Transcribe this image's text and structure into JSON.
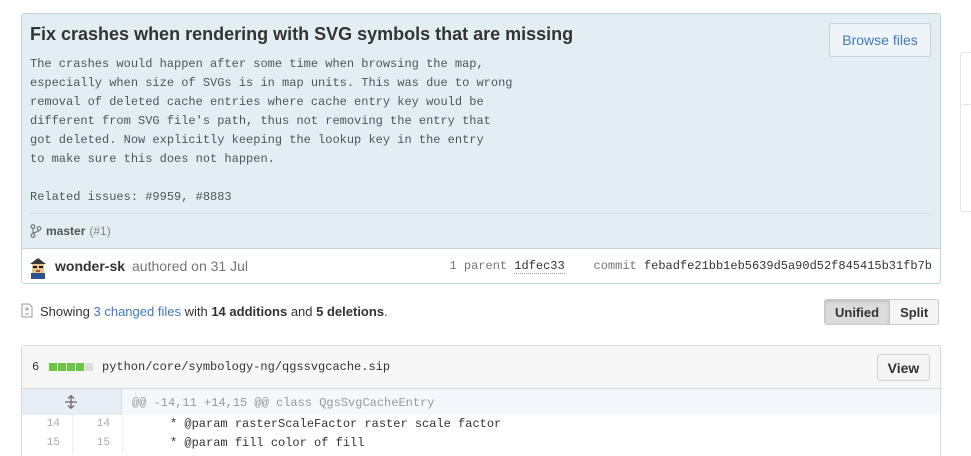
{
  "commit": {
    "title": "Fix crashes when rendering with SVG symbols that are missing",
    "description": "The crashes would happen after some time when browsing the map,\nespecially when size of SVGs is in map units. This was due to wrong\nremoval of deleted cache entries where cache entry key would be\ndifferent from SVG file's path, thus not removing the entry that\ngot deleted. Now explicitly keeping the lookup key in the entry\nto make sure this does not happen.\n\nRelated issues: #9959, #8883",
    "browse_label": "Browse files",
    "branch": "master",
    "pr": "(#1)",
    "author": "wonder-sk",
    "authored_text": "authored on 31 Jul",
    "parent_label": "1 parent",
    "parent_sha": "1dfec33",
    "commit_label": "commit",
    "commit_sha": "febadfe21bb1eb5639d5a90d52f845415b31fb7b"
  },
  "toc": {
    "showing": "Showing",
    "changed_files": "3 changed files",
    "with": "with",
    "additions": "14 additions",
    "and": "and",
    "deletions": "5 deletions",
    "period": ".",
    "unified": "Unified",
    "split": "Split"
  },
  "file": {
    "count": "6",
    "path": "python/core/symbology-ng/qgssvgcache.sip",
    "view_label": "View",
    "hunk": "@@ -14,11 +14,15 @@ class QgsSvgCacheEntry",
    "lines": [
      {
        "old": "14",
        "new": "14",
        "code": "     * @param rasterScaleFactor raster scale factor"
      },
      {
        "old": "15",
        "new": "15",
        "code": "     * @param fill color of fill"
      }
    ]
  },
  "colors": {
    "link": "#4078c0",
    "commit_bg": "#e3eef3",
    "addition": "#6cc644"
  }
}
